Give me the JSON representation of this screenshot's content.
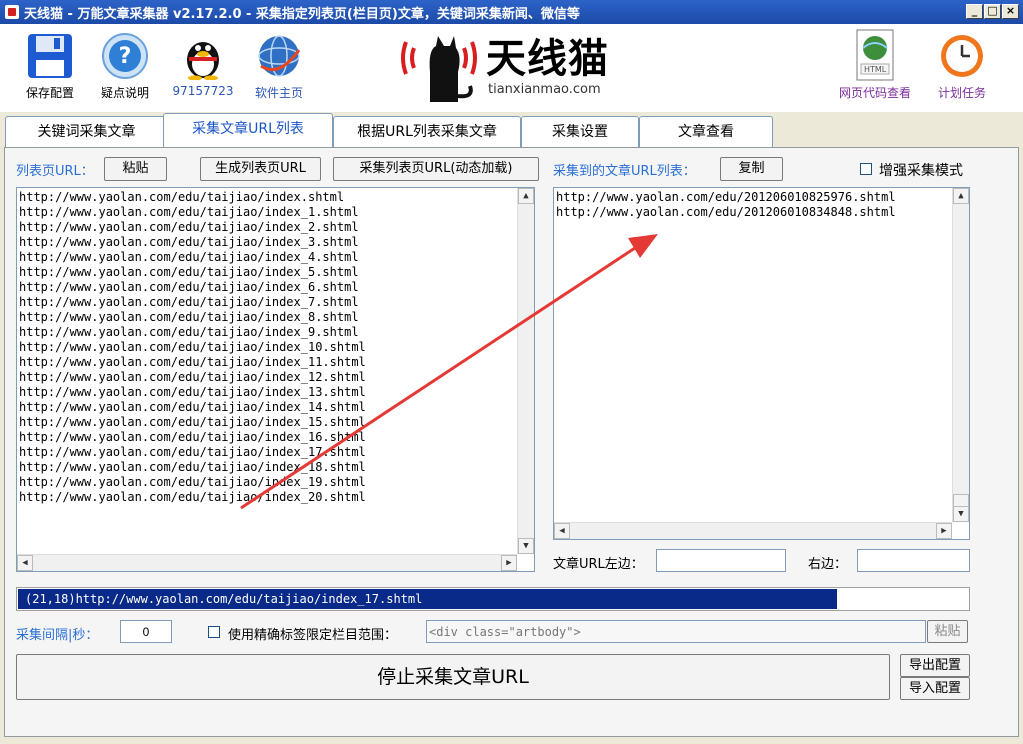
{
  "window": {
    "title": "天线猫 - 万能文章采集器 v2.17.2.0 - 采集指定列表页(栏目页)文章，关键词采集新闻、微信等",
    "controls": {
      "minimize": "_",
      "maximize": "□",
      "close": "×"
    }
  },
  "toolbar": {
    "save_config": "保存配置",
    "help": "疑点说明",
    "qq": "97157723",
    "homepage": "软件主页",
    "logo_text": "天线猫",
    "logo_domain": "tianxianmao.com",
    "html_view": "网页代码查看",
    "html_icon_label": "HTML",
    "schedule": "计划任务"
  },
  "tabs": [
    {
      "label": "关键词采集文章"
    },
    {
      "label": "采集文章URL列表"
    },
    {
      "label": "根据URL列表采集文章"
    },
    {
      "label": "采集设置"
    },
    {
      "label": "文章查看"
    }
  ],
  "left": {
    "label": "列表页URL：",
    "paste_button": "粘贴",
    "gen_button": "生成列表页URL",
    "collect_button": "采集列表页URL(动态加载)",
    "urls": [
      "http://www.yaolan.com/edu/taijiao/index.shtml",
      "http://www.yaolan.com/edu/taijiao/index_1.shtml",
      "http://www.yaolan.com/edu/taijiao/index_2.shtml",
      "http://www.yaolan.com/edu/taijiao/index_3.shtml",
      "http://www.yaolan.com/edu/taijiao/index_4.shtml",
      "http://www.yaolan.com/edu/taijiao/index_5.shtml",
      "http://www.yaolan.com/edu/taijiao/index_6.shtml",
      "http://www.yaolan.com/edu/taijiao/index_7.shtml",
      "http://www.yaolan.com/edu/taijiao/index_8.shtml",
      "http://www.yaolan.com/edu/taijiao/index_9.shtml",
      "http://www.yaolan.com/edu/taijiao/index_10.shtml",
      "http://www.yaolan.com/edu/taijiao/index_11.shtml",
      "http://www.yaolan.com/edu/taijiao/index_12.shtml",
      "http://www.yaolan.com/edu/taijiao/index_13.shtml",
      "http://www.yaolan.com/edu/taijiao/index_14.shtml",
      "http://www.yaolan.com/edu/taijiao/index_15.shtml",
      "http://www.yaolan.com/edu/taijiao/index_16.shtml",
      "http://www.yaolan.com/edu/taijiao/index_17.shtml",
      "http://www.yaolan.com/edu/taijiao/index_18.shtml",
      "http://www.yaolan.com/edu/taijiao/index_19.shtml",
      "http://www.yaolan.com/edu/taijiao/index_20.shtml"
    ]
  },
  "right": {
    "label": "采集到的文章URL列表：",
    "copy_button": "复制",
    "enhance_label": "增强采集模式",
    "urls": [
      "http://www.yaolan.com/edu/201206010825976.shtml",
      "http://www.yaolan.com/edu/201206010834848.shtml"
    ],
    "left_edge_label": "文章URL左边：",
    "left_edge_value": "",
    "right_edge_label": "右边：",
    "right_edge_value": ""
  },
  "status": {
    "text": "(21,18)http://www.yaolan.com/edu/taijiao/index_17.shtml",
    "progress": 0.86
  },
  "bottom": {
    "interval_label": "采集间隔|秒：",
    "interval_value": "0",
    "precise_label": "使用精确标签限定栏目范围：",
    "precise_value": "<div class=\"artbody\">",
    "precise_paste": "粘贴",
    "stop_button": "停止采集文章URL",
    "export_button": "导出配置",
    "import_button": "导入配置"
  },
  "colors": {
    "titlebar": "#2d63c8",
    "accent_blue": "#2a6fd6",
    "progress_fill": "#0a2a8a",
    "arrow_red": "#e53935",
    "toolbar_link": "#7b2d9b"
  }
}
